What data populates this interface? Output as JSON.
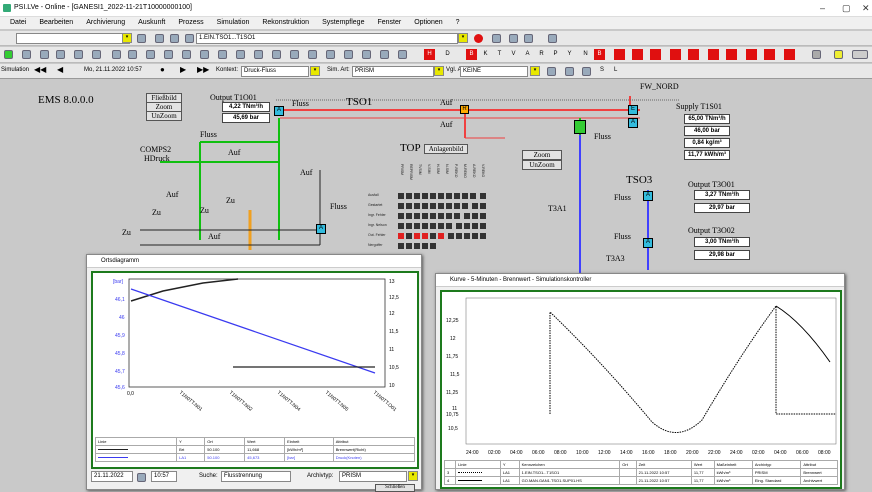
{
  "window": {
    "title": "PSI.LVe - Online - [GANESI1_2022-11-21T10000000100]"
  },
  "menu": [
    "Datei",
    "Bearbeiten",
    "Archivierung",
    "Auskunft",
    "Prozess",
    "Simulation",
    "Rekonstruktion",
    "Systempflege",
    "Fenster",
    "Optionen",
    "?"
  ],
  "toolbar": {
    "object_field": "1.EIN.TSO1...T1SO1"
  },
  "sim": {
    "label": "Simulation",
    "datetime": "Mo, 21.11.2022 10:57",
    "kontext_label": "Kontext:",
    "kontext": "Druck-Fluss",
    "simart_label": "Sim. Art:",
    "simart": "PRISM",
    "vglart_label": "Vgl. Art:",
    "vglart": "KEINE",
    "s": "S",
    "l": "L"
  },
  "letters": [
    "H",
    "D",
    "B",
    "K",
    "T",
    "V",
    "A",
    "R",
    "P",
    "Y",
    "N",
    "B"
  ],
  "scheme": {
    "ems": "EMS 8.0.0.0",
    "fliessbild": "Fließbild",
    "zoom": "Zoom",
    "unzoom": "UnZoom",
    "output_t1o01": "Output T1O01",
    "out1_flow": "4,22 TNm³/h",
    "out1_press": "45,69 bar",
    "tso1": "TSO1",
    "fw_nord": "FW_NORD",
    "supply": "Supply T1S01",
    "sup_flow": "65,00 TNm³/h",
    "sup_press": "46,00 bar",
    "sup_dens": "0,84 kg/m³",
    "sup_cal": "11,77 kWh/m³",
    "compressor": "COMPS2",
    "hdruck": "HDruck",
    "top": "TOP",
    "anlagenbild": "Anlagenbild",
    "zoom2": "Zoom",
    "unzoom2": "UnZoom",
    "tso3": "TSO3",
    "t3a1": "T3A1",
    "t3a3": "T3A3",
    "output_t3o01": "Output T3O01",
    "o3_flow": "3,27 TNm³/h",
    "o3_press": "29,97 bar",
    "output_t3o02": "Output T3O02",
    "o4_flow": "3,00 TNm³/h",
    "o4_press": "29,98 bar",
    "fluss": "Fluss",
    "auf": "Auf",
    "zu": "Zu",
    "grid_rows": [
      "Ausfall",
      "Gestartet",
      "Ingr. Fehler",
      "Ingr. Nelson",
      "Out. Fehler",
      "Nergoffer"
    ],
    "grid_cols": [
      "PRISM",
      "REPRISM",
      "TVSIM",
      "V-SIM",
      "H-SIM",
      "N-SIM",
      "P-REKO",
      "M-REKO",
      "A-REKO",
      "V-REKO"
    ]
  },
  "ortsdiag": {
    "title": "Ortsdiagramm",
    "yunit": "[bar]",
    "y2unit": "13",
    "yticks": [
      "46,1",
      "46",
      "45,9",
      "45,8",
      "45,7",
      "45,6"
    ],
    "y2ticks": [
      "13",
      "12,5",
      "12",
      "11,5",
      "11",
      "10,5",
      "10"
    ],
    "xticks": [
      "0,0",
      "T1N0TT.N01",
      "T1N0TT.N02",
      "T1N0TT.N04",
      "T1N0TT.N05",
      "T1N0TT.O01"
    ],
    "table_head": [
      "Linie",
      "Y",
      "Ort",
      "Wert",
      "Einheit",
      "Attribut"
    ],
    "rows": [
      [
        "",
        "Brt",
        "50.100",
        "11,668",
        "[kWh/m³]",
        "Brennwert(Richt)"
      ],
      [
        "",
        "LA1",
        "50.100",
        "45,673",
        "[bar]",
        "Druck(Knoten)"
      ]
    ],
    "date": "21.11.2022",
    "time": "10:57",
    "suche_label": "Suche:",
    "suche": "Flusstrennung",
    "archivtyp_label": "Archivtyp:",
    "archivtyp": "PRISM",
    "schliessen": "Schließen"
  },
  "kurve": {
    "title": "Kurve - 5-Minuten - Brennwert - Simulationskontroller",
    "yticks": [
      "12,25",
      "12",
      "11,75",
      "11,5",
      "11,25",
      "11",
      "10,75",
      "10,5"
    ],
    "xticks": [
      "24:00",
      "02:00",
      "04:00",
      "06:00",
      "08:00",
      "10:00",
      "12:00",
      "14:00",
      "16:00",
      "18:00",
      "20:00",
      "22:00",
      "24:00",
      "02:00",
      "04:00",
      "06:00",
      "08:00"
    ],
    "table_head": [
      "",
      "Linie",
      "Y",
      "Kennzeichen",
      "Ort",
      "Zeit",
      "Wert",
      "Maßeinheit",
      "Archivtyp",
      "Attribut"
    ],
    "rows": [
      [
        "3",
        "",
        "LA1",
        "1.EIN.TSO1...T1SO1",
        "",
        "21.11.2022 10:57",
        "11,77",
        "kWh/m³",
        "PRISM",
        "Brennwert"
      ],
      [
        "4",
        "",
        "LA1",
        "GO.MAN.GAN1.TSO1.SUP01.HS",
        "",
        "21.11.2022 10:57",
        "11,77",
        "kWh/m³",
        "Eing. Standard",
        "Archivwert"
      ]
    ]
  },
  "colors": {
    "green": "#1d7a1d",
    "blue": "#3a3af0",
    "red": "#e01010",
    "pipe_green": "#10c010",
    "pipe_red": "#f04040",
    "pipe_blue": "#4040ff",
    "orange": "#f0a020"
  }
}
